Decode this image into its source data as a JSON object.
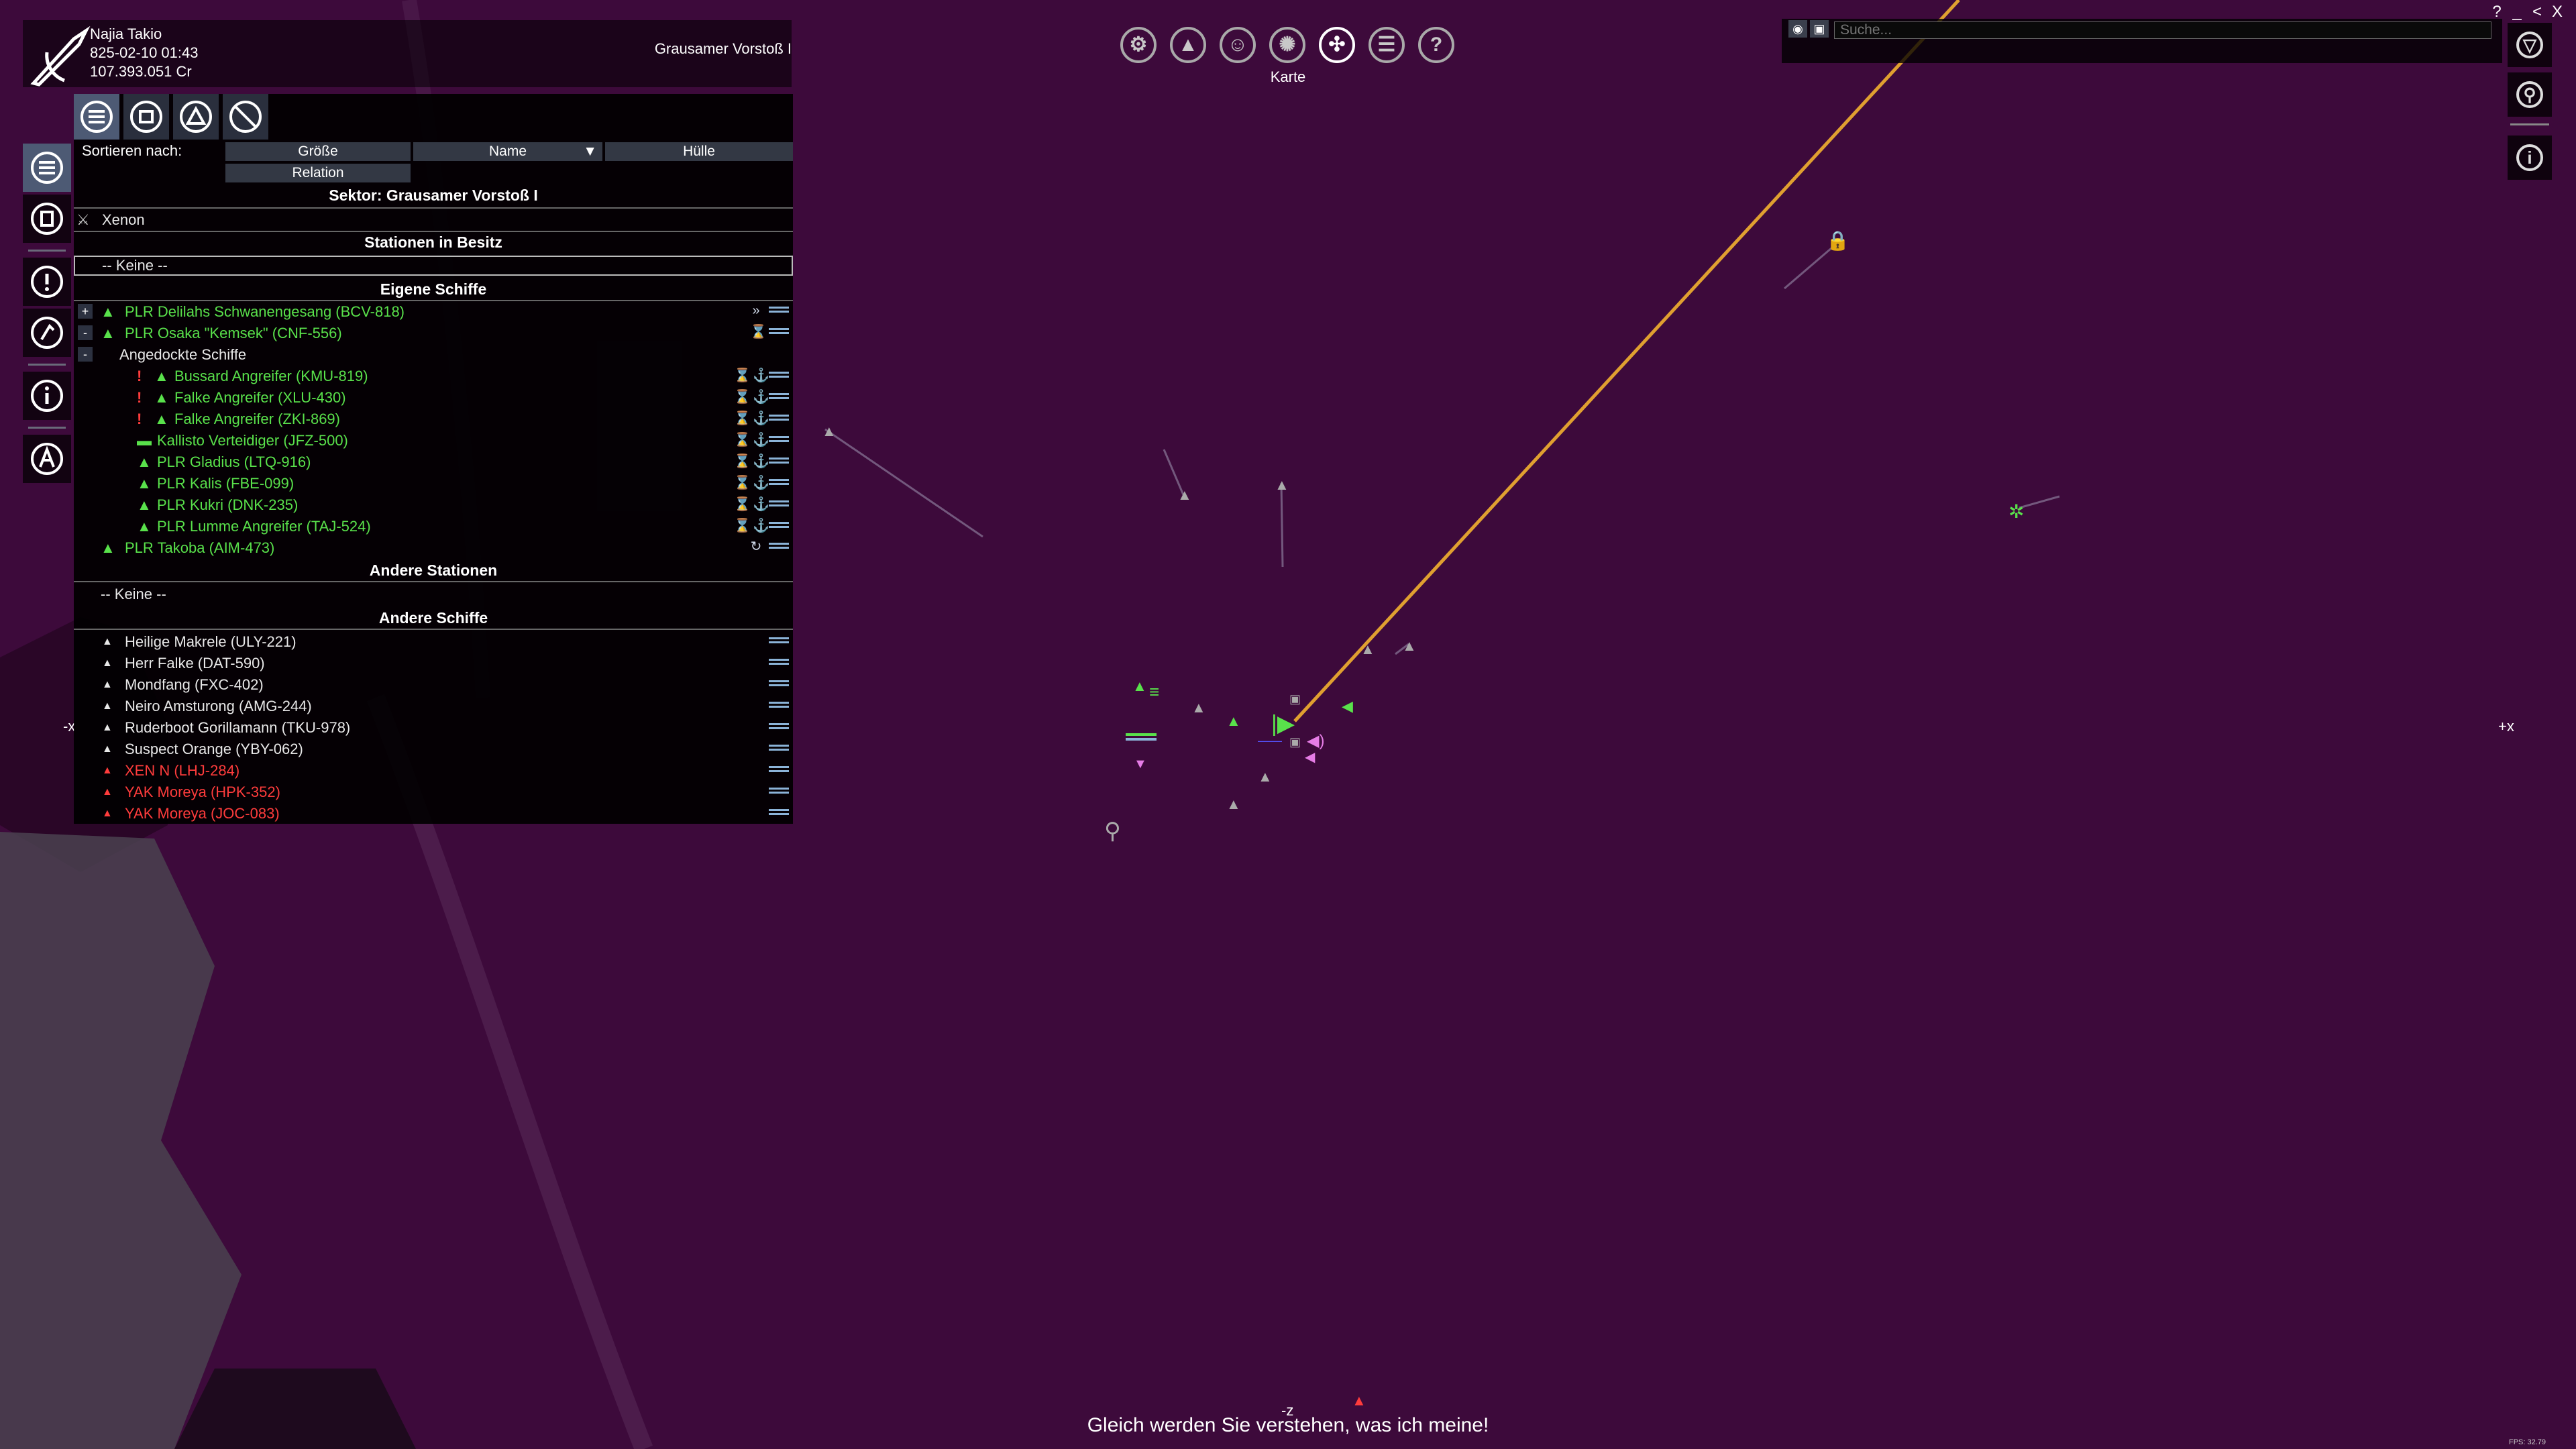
{
  "player": {
    "name": "Najia Takio",
    "datetime": "825-02-10 01:43",
    "credits": "107.393.051 Cr",
    "sector": "Grausamer Vorstoß I"
  },
  "panel": {
    "sort_label": "Sortieren nach:",
    "sort_options": [
      "Größe",
      "Name",
      "Hülle",
      "Relation"
    ],
    "sector_title": "Sektor: Grausamer Vorstoß I",
    "faction": "Xenon",
    "sections": {
      "owned_stations": "Stationen in Besitz",
      "own_ships": "Eigene Schiffe",
      "other_stations": "Andere Stationen",
      "other_ships": "Andere Schiffe"
    },
    "none_label": "-- Keine --",
    "docked_label": "Angedockte Schiffe",
    "own_ships": [
      {
        "name": "PLR Delilahs Schwanengesang (BCV-818)",
        "expander": "+"
      },
      {
        "name": "PLR Osaka \"Kemsek\" (CNF-556)",
        "expander": "-"
      }
    ],
    "docked_ships": [
      {
        "name": "Bussard Angreifer (KMU-819)",
        "alert": "!"
      },
      {
        "name": "Falke Angreifer (XLU-430)",
        "alert": "!"
      },
      {
        "name": "Falke Angreifer (ZKI-869)",
        "alert": "!"
      },
      {
        "name": "Kallisto Verteidiger (JFZ-500)",
        "alert": ""
      },
      {
        "name": "PLR Gladius (LTQ-916)",
        "alert": ""
      },
      {
        "name": "PLR Kalis (FBE-099)",
        "alert": ""
      },
      {
        "name": "PLR Kukri (DNK-235)",
        "alert": ""
      },
      {
        "name": "PLR Lumme Angreifer (TAJ-524)",
        "alert": ""
      }
    ],
    "own_ship_last": {
      "name": "PLR Takoba (AIM-473)"
    },
    "other_ships": [
      {
        "name": "Heilige Makrele (ULY-221)",
        "color": "#e8e8e8"
      },
      {
        "name": "Herr Falke (DAT-590)",
        "color": "#e8e8e8"
      },
      {
        "name": "Mondfang (FXC-402)",
        "color": "#e8e8e8"
      },
      {
        "name": "Neiro Amsturong (AMG-244)",
        "color": "#e8e8e8"
      },
      {
        "name": "Ruderboot Gorillamann (TKU-978)",
        "color": "#e8e8e8"
      },
      {
        "name": "Suspect Orange (YBY-062)",
        "color": "#e8e8e8"
      },
      {
        "name": "XEN N (LHJ-284)",
        "color": "#ff3c3c"
      },
      {
        "name": "YAK Moreya (HPK-352)",
        "color": "#ff3c3c"
      },
      {
        "name": "YAK Moreya (JOC-083)",
        "color": "#ff3c3c"
      }
    ]
  },
  "toolbar": {
    "active_label": "Karte",
    "icons": [
      "gear-icon",
      "ship-icon",
      "person-icon",
      "faction-icon",
      "map-icon",
      "encyclopedia-icon",
      "help-icon"
    ]
  },
  "search": {
    "placeholder": "Suche..."
  },
  "window_controls": [
    "?",
    "_",
    "<",
    "X"
  ],
  "map_labels": {
    "plus_x": "+x",
    "minus_x": "-x",
    "minus_z": "-z",
    "fps": "FPS: 32.79"
  },
  "subtitle": "Gleich werden Sie verstehen, was ich meine!",
  "colors": {
    "background": "#3d0a3b",
    "own": "#59e14b",
    "hostile": "#ff3c3c",
    "neutral": "#e8e8e8",
    "route": "#e0a030"
  }
}
